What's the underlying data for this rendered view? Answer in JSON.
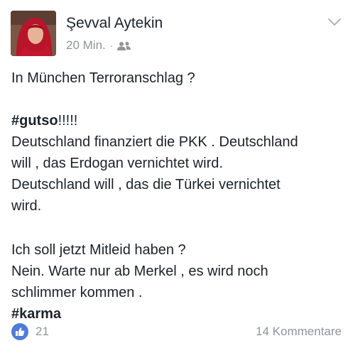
{
  "post": {
    "author": "Şevval Aytekin",
    "time": "20 Min.",
    "separator": "·",
    "audience_icon": "friends-icon",
    "menu_icon": "chevron-down-icon",
    "lines": {
      "l1": "In München Terroranschlag ?",
      "l2": "#gutso",
      "l2b": "!!!!!",
      "l3": "Deutschland finanziert die PKK . Deutschland",
      "l4": "will , das Erdogan vernichtet wird.",
      "l5": "Deutschland will , das die Türkei vernichtet",
      "l6": "wird.",
      "l7": "Ich soll jetzt Mitleid haben ?",
      "l8": "Nein. Warte nur ab Merkel , es wird noch",
      "l9": "schlimmer kommen .",
      "l10": "#karma"
    }
  },
  "footer": {
    "like_icon": "thumbs-up-icon",
    "like_count": "21",
    "comments": "14 Kommentare"
  },
  "colors": {
    "text": "#1d2129",
    "muted": "#90949c",
    "like_blue": "#4f7bd9"
  }
}
